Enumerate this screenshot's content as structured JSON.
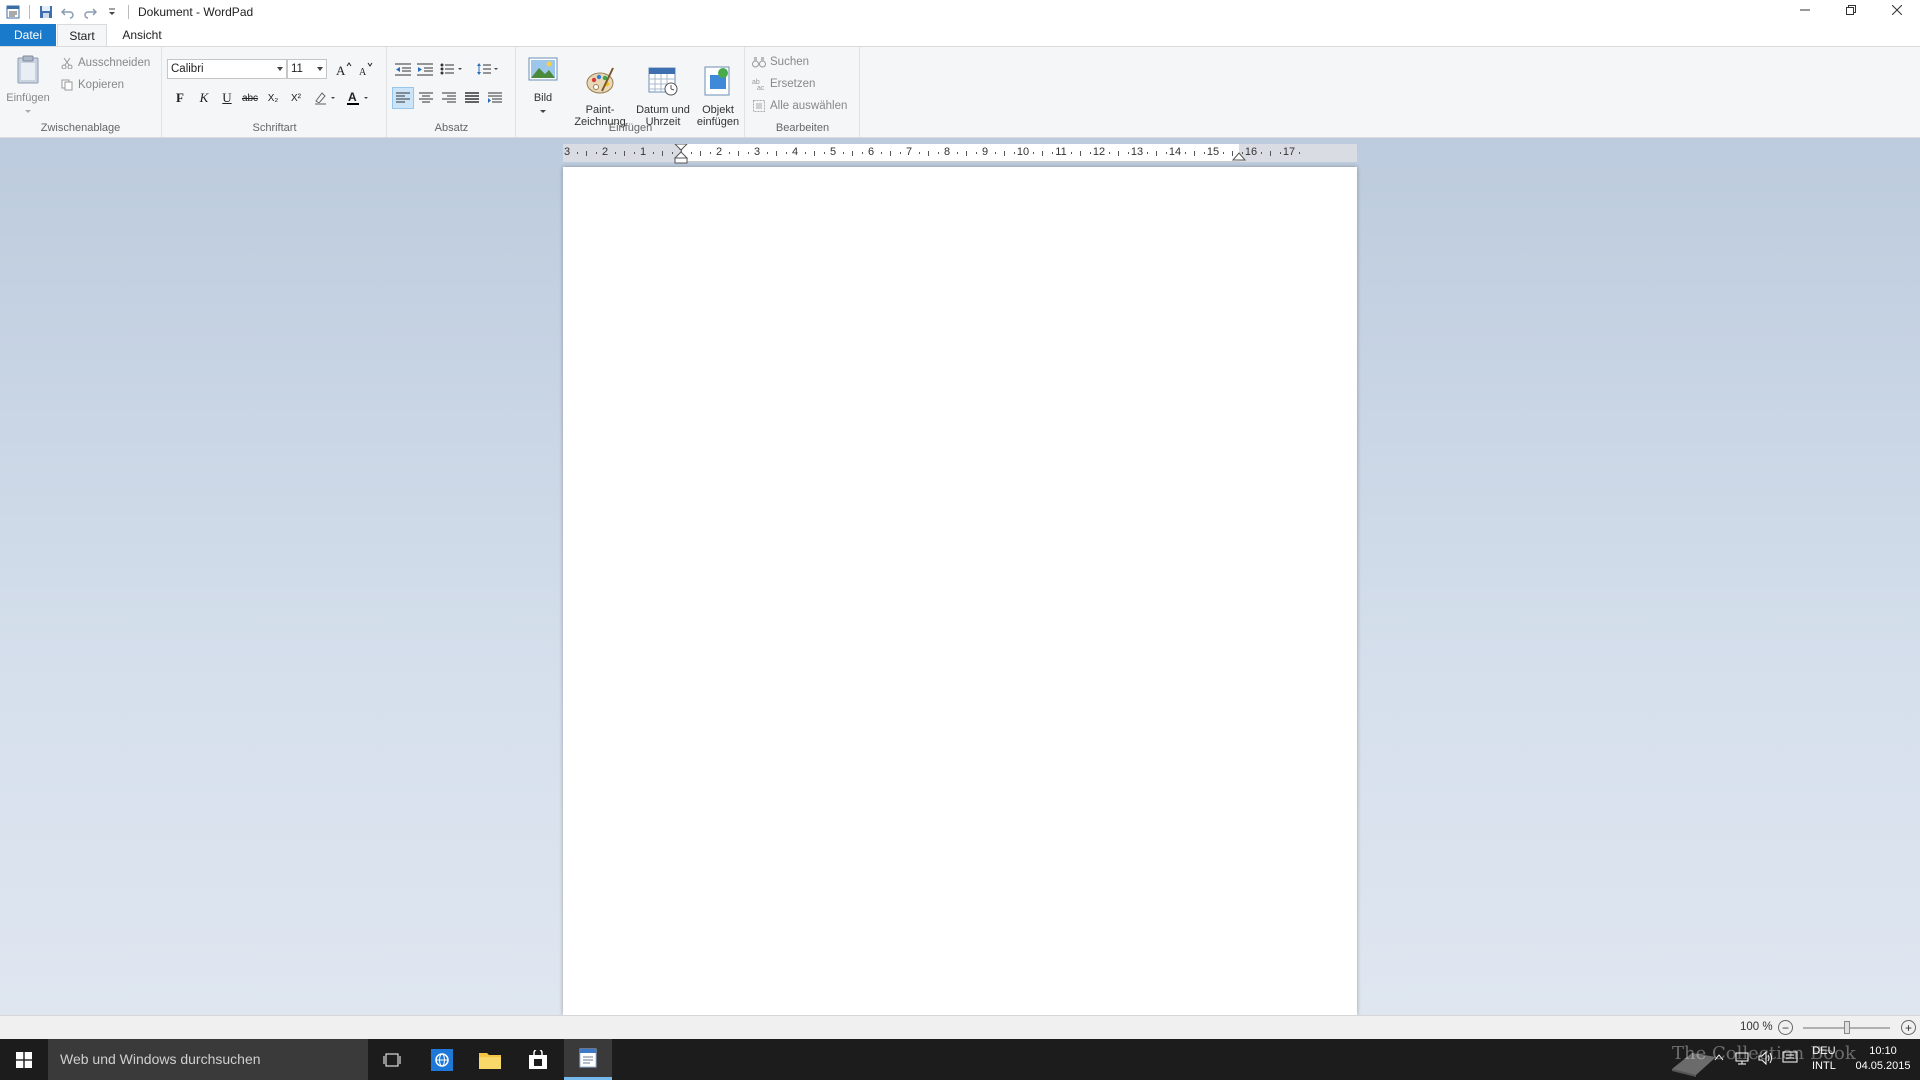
{
  "window": {
    "title": "Dokument - WordPad"
  },
  "tabs": {
    "file": "Datei",
    "start": "Start",
    "view": "Ansicht"
  },
  "ribbon": {
    "clipboard": {
      "label": "Zwischenablage",
      "paste": "Einfügen",
      "cut": "Ausschneiden",
      "copy": "Kopieren"
    },
    "font": {
      "label": "Schriftart",
      "family": "Calibri",
      "size": "11",
      "bold": "F",
      "italic": "K",
      "underline": "U",
      "strike": "abc",
      "subscript": "X₂",
      "superscript": "X²"
    },
    "paragraph": {
      "label": "Absatz"
    },
    "insert": {
      "label": "Einfügen",
      "picture": "Bild",
      "paint": "Paint-\nZeichnung",
      "datetime": "Datum und\nUhrzeit",
      "object": "Objekt\neinfügen"
    },
    "editing": {
      "label": "Bearbeiten",
      "find": "Suchen",
      "replace": "Ersetzen",
      "select_all": "Alle auswählen"
    }
  },
  "ruler": {
    "labels": [
      "3",
      "2",
      "1",
      "1",
      "2",
      "3",
      "4",
      "5",
      "6",
      "7",
      "8",
      "9",
      "10",
      "11",
      "12",
      "13",
      "14",
      "15",
      "16",
      "17"
    ]
  },
  "statusbar": {
    "zoom": "100 %",
    "zoom_level": 100
  },
  "taskbar": {
    "search_placeholder": "Web und Windows durchsuchen",
    "lang_top": "DEU",
    "lang_bottom": "INTL",
    "time": "10:10",
    "date": "04.05.2015",
    "watermark": "The Collection Book"
  },
  "colors": {
    "file_tab": "#1979ca",
    "accent": "#76b9ed"
  }
}
